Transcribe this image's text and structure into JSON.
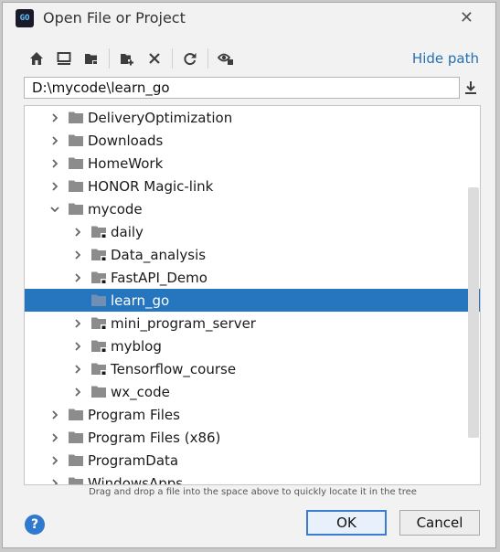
{
  "window": {
    "title": "Open File or Project",
    "app_icon_text": "GO",
    "close_icon": "close-icon"
  },
  "toolbar": {
    "buttons": [
      "home-icon",
      "desktop-icon",
      "project-folder-icon",
      "new-folder-icon",
      "delete-icon",
      "refresh-icon",
      "show-hidden-icon"
    ],
    "hide_path_label": "Hide path"
  },
  "path": {
    "value": "D:\\mycode\\learn_go",
    "download_icon": "download-icon"
  },
  "tree": {
    "items": [
      {
        "label": "DeliveryOptimization",
        "depth": 0,
        "expanded": false,
        "project": false,
        "selected": false,
        "has_children": true
      },
      {
        "label": "Downloads",
        "depth": 0,
        "expanded": false,
        "project": false,
        "selected": false,
        "has_children": true
      },
      {
        "label": "HomeWork",
        "depth": 0,
        "expanded": false,
        "project": false,
        "selected": false,
        "has_children": true
      },
      {
        "label": "HONOR Magic-link",
        "depth": 0,
        "expanded": false,
        "project": false,
        "selected": false,
        "has_children": true
      },
      {
        "label": "mycode",
        "depth": 0,
        "expanded": true,
        "project": false,
        "selected": false,
        "has_children": true
      },
      {
        "label": "daily",
        "depth": 1,
        "expanded": false,
        "project": true,
        "selected": false,
        "has_children": true
      },
      {
        "label": "Data_analysis",
        "depth": 1,
        "expanded": false,
        "project": true,
        "selected": false,
        "has_children": true
      },
      {
        "label": "FastAPI_Demo",
        "depth": 1,
        "expanded": false,
        "project": true,
        "selected": false,
        "has_children": true
      },
      {
        "label": "learn_go",
        "depth": 1,
        "expanded": false,
        "project": false,
        "selected": true,
        "has_children": false
      },
      {
        "label": "mini_program_server",
        "depth": 1,
        "expanded": false,
        "project": true,
        "selected": false,
        "has_children": true
      },
      {
        "label": "myblog",
        "depth": 1,
        "expanded": false,
        "project": true,
        "selected": false,
        "has_children": true
      },
      {
        "label": "Tensorflow_course",
        "depth": 1,
        "expanded": false,
        "project": true,
        "selected": false,
        "has_children": true
      },
      {
        "label": "wx_code",
        "depth": 1,
        "expanded": false,
        "project": false,
        "selected": false,
        "has_children": true
      },
      {
        "label": "Program Files",
        "depth": 0,
        "expanded": false,
        "project": false,
        "selected": false,
        "has_children": true
      },
      {
        "label": "Program Files (x86)",
        "depth": 0,
        "expanded": false,
        "project": false,
        "selected": false,
        "has_children": true
      },
      {
        "label": "ProgramData",
        "depth": 0,
        "expanded": false,
        "project": false,
        "selected": false,
        "has_children": true
      },
      {
        "label": "WindowsApps",
        "depth": 0,
        "expanded": false,
        "project": false,
        "selected": false,
        "has_children": true
      }
    ]
  },
  "hint": "Drag and drop a file into the space above to quickly locate it in the tree",
  "footer": {
    "help_label": "?",
    "ok_label": "OK",
    "cancel_label": "Cancel"
  },
  "colors": {
    "accent": "#2675bf",
    "folder": "#8c8c8c",
    "link": "#2470b3"
  }
}
